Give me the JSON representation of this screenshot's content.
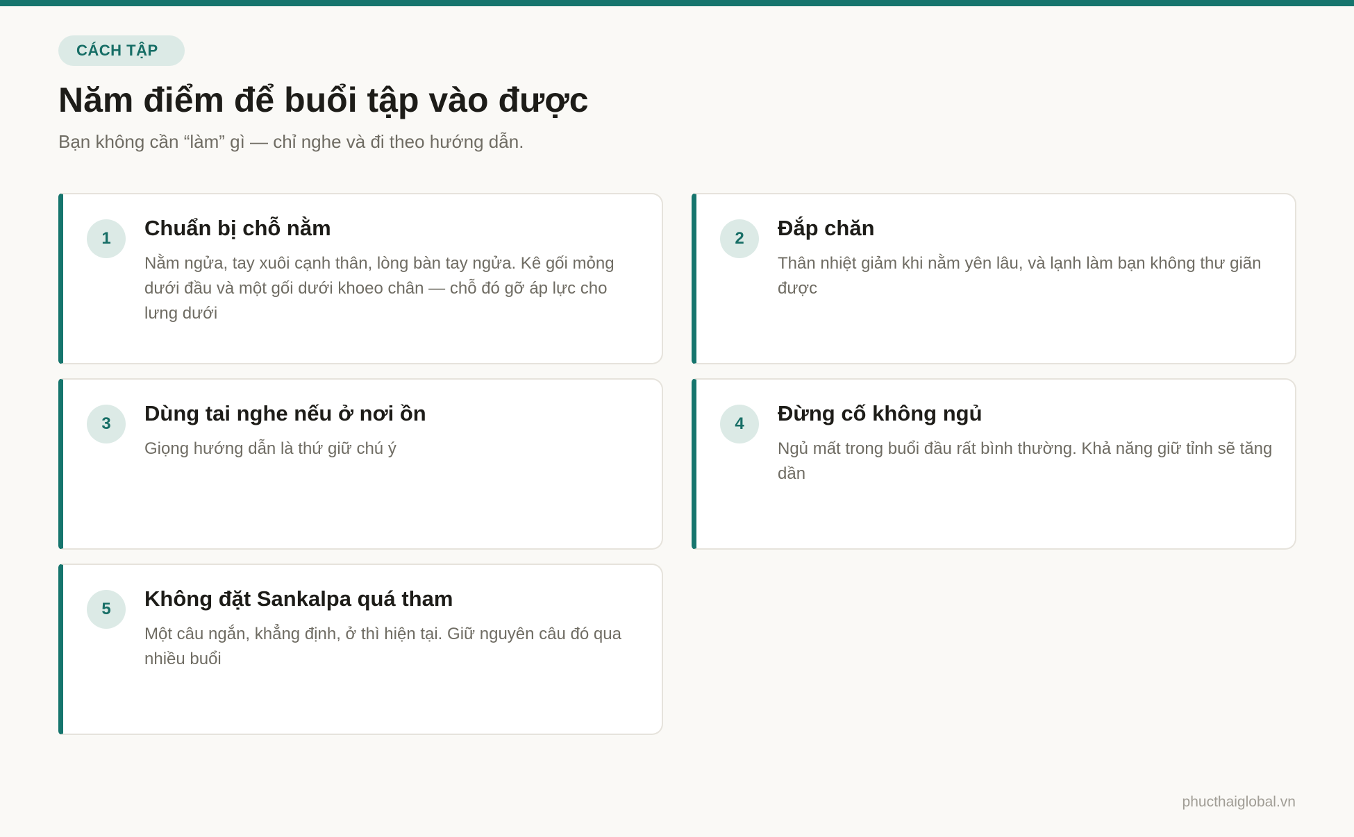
{
  "header": {
    "tag": "CÁCH TẬP",
    "title": "Năm điểm để buổi tập vào được",
    "subtitle": "Bạn không cần “làm” gì — chỉ nghe và đi theo hướng dẫn."
  },
  "cards": [
    {
      "number": "1",
      "title": "Chuẩn bị chỗ nằm",
      "description": "Nằm ngửa, tay xuôi cạnh thân, lòng bàn tay ngửa. Kê gối mỏng dưới đầu và một gối dưới khoeo chân — chỗ đó gỡ áp lực cho lưng dưới"
    },
    {
      "number": "2",
      "title": "Đắp chăn",
      "description": "Thân nhiệt giảm khi nằm yên lâu, và lạnh làm bạn không thư giãn được"
    },
    {
      "number": "3",
      "title": "Dùng tai nghe nếu ở nơi ồn",
      "description": "Giọng hướng dẫn là thứ giữ chú ý"
    },
    {
      "number": "4",
      "title": "Đừng cố không ngủ",
      "description": "Ngủ mất trong buổi đầu rất bình thường. Khả năng giữ tỉnh sẽ tăng dần"
    },
    {
      "number": "5",
      "title": "Không đặt Sankalpa quá tham",
      "description": "Một câu ngắn, khẳng định, ở thì hiện tại. Giữ nguyên câu đó qua nhiều buổi"
    }
  ],
  "footer": {
    "site": "phucthaiglobal.vn"
  },
  "colors": {
    "accent": "#16756d",
    "badge_bg": "#dceae6",
    "background": "#faf9f6"
  }
}
